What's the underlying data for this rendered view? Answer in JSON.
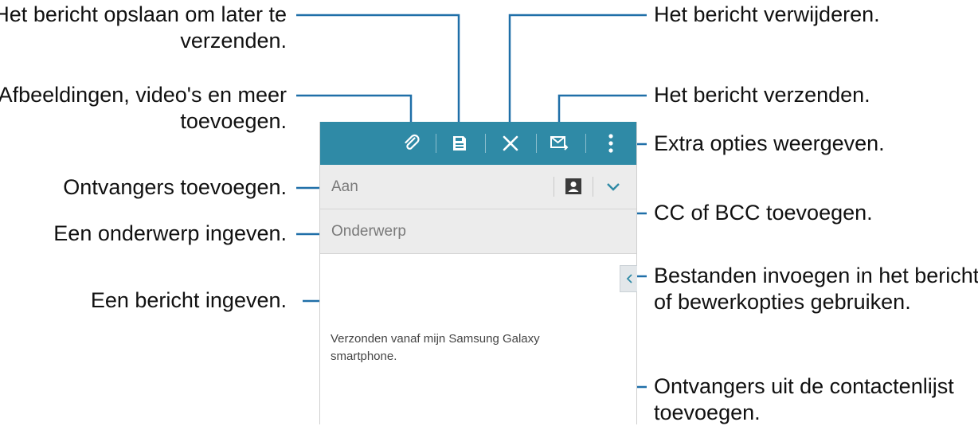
{
  "annotations": {
    "save_for_later": [
      "Het bericht opslaan om later te",
      "verzenden."
    ],
    "attach": [
      "Afbeeldingen, video's en meer",
      "toevoegen."
    ],
    "add_recipients": "Ontvangers toevoegen.",
    "enter_subject": "Een onderwerp ingeven.",
    "enter_message": "Een bericht ingeven.",
    "delete": "Het bericht verwijderen.",
    "send": "Het bericht verzenden.",
    "more_options": "Extra opties weergeven.",
    "cc_bcc": "CC of BCC toevoegen.",
    "insert_files": [
      "Bestanden invoegen in het bericht,",
      "of bewerkopties gebruiken."
    ],
    "contacts": [
      "Ontvangers uit de contactenlijst",
      "toevoegen."
    ]
  },
  "email": {
    "to_placeholder": "Aan",
    "subject_placeholder": "Onderwerp",
    "body_lines": [
      "Verzonden vanaf mijn Samsung Galaxy",
      "smartphone."
    ]
  },
  "icons": {
    "actionbar": [
      "paperclip-icon",
      "save-icon",
      "close-icon",
      "send-mail-icon",
      "more-vert-icon"
    ],
    "to_field": [
      "contact-icon",
      "chevron-down-icon"
    ],
    "side": "chevron-left-icon"
  },
  "colors": {
    "actionbar": "#2f8aa6",
    "field_bg": "#ececec",
    "leader_line": "#1f6fa8",
    "icon_accent": "#2f8aa6"
  }
}
